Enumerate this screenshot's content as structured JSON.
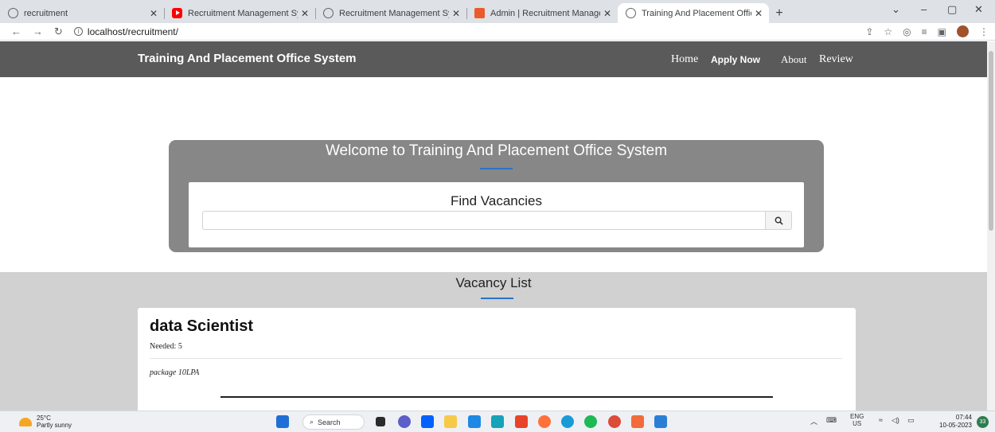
{
  "browser": {
    "tabs": [
      {
        "title": "recruitment",
        "favicon": "globe-icon"
      },
      {
        "title": "Recruitment Management Systen",
        "favicon": "youtube-icon"
      },
      {
        "title": "Recruitment Management Systen",
        "favicon": "globe-icon"
      },
      {
        "title": "Admin | Recruitment Managemen",
        "favicon": "admin-icon"
      },
      {
        "title": "Training And Placement Office Sy",
        "favicon": "globe-icon",
        "active": true
      }
    ],
    "url": "localhost/recruitment/"
  },
  "site": {
    "brand": "Training And Placement Office System",
    "nav": {
      "home": "Home",
      "apply": "Apply Now",
      "about": "About",
      "review": "Review"
    },
    "colors": {
      "header": "#5a5a5a",
      "hero": "#878787",
      "accent": "#2a73c9",
      "section": "#d1d1d1"
    }
  },
  "hero": {
    "title": "Welcome to Training And Placement Office System",
    "search_title": "Find Vacancies",
    "search_value": "",
    "search_placeholder": ""
  },
  "vacancy_list": {
    "title": "Vacancy List",
    "items": [
      {
        "title": "data Scientist",
        "needed": "Needed: 5",
        "description": "package 10LPA"
      }
    ]
  },
  "taskbar": {
    "temperature": "25°C",
    "weather": "Partly sunny",
    "search": "Search",
    "lang_top": "ENG",
    "lang_bottom": "US",
    "time": "07:44",
    "date": "10-05-2023",
    "notifications": "33"
  }
}
